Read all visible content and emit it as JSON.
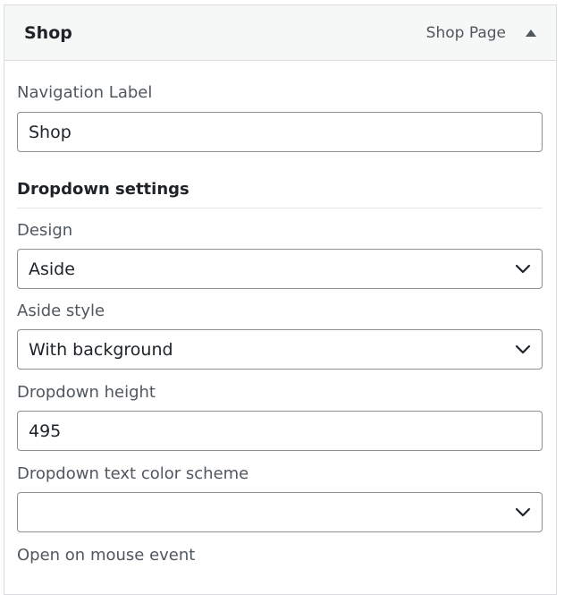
{
  "header": {
    "title": "Shop",
    "item_type": "Shop Page"
  },
  "navigation_label": {
    "label": "Navigation Label",
    "value": "Shop"
  },
  "dropdown_settings": {
    "heading": "Dropdown settings"
  },
  "design": {
    "label": "Design",
    "selected": "Aside"
  },
  "aside_style": {
    "label": "Aside style",
    "selected": "With background"
  },
  "dropdown_height": {
    "label": "Dropdown height",
    "value": "495"
  },
  "text_color_scheme": {
    "label": "Dropdown text color scheme",
    "selected": ""
  },
  "open_on_mouse_event": {
    "label": "Open on mouse event"
  },
  "icons": {
    "toggle": "triangle-up-icon",
    "select_arrow": "chevron-down-icon"
  }
}
